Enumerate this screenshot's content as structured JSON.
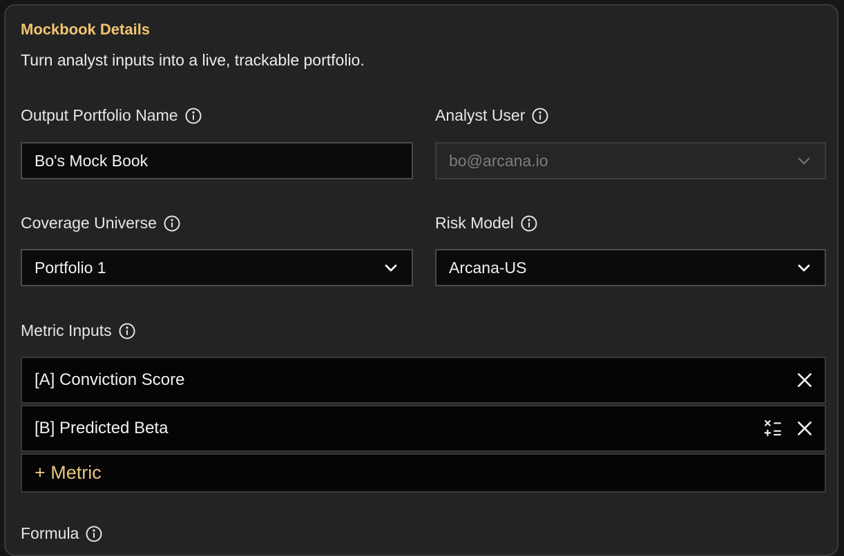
{
  "header": {
    "title": "Mockbook Details",
    "subtitle": "Turn analyst inputs into a live, trackable portfolio."
  },
  "fields": {
    "portfolio_name": {
      "label": "Output Portfolio Name",
      "value": "Bo's Mock Book"
    },
    "analyst_user": {
      "label": "Analyst User",
      "value": "bo@arcana.io"
    },
    "coverage_universe": {
      "label": "Coverage Universe",
      "value": "Portfolio 1"
    },
    "risk_model": {
      "label": "Risk Model",
      "value": "Arcana-US"
    }
  },
  "metrics": {
    "label": "Metric Inputs",
    "items": [
      {
        "label": "[A] Conviction Score"
      },
      {
        "label": "[B] Predicted Beta"
      }
    ],
    "add_label": "+ Metric"
  },
  "formula": {
    "label": "Formula"
  },
  "colors": {
    "accent": "#f2c46f",
    "panel_bg": "#232323",
    "field_bg": "#0b0b0b",
    "disabled_bg": "#262626"
  },
  "icons": [
    "info-icon",
    "chevron-down-icon",
    "close-icon",
    "calculator-icon"
  ]
}
